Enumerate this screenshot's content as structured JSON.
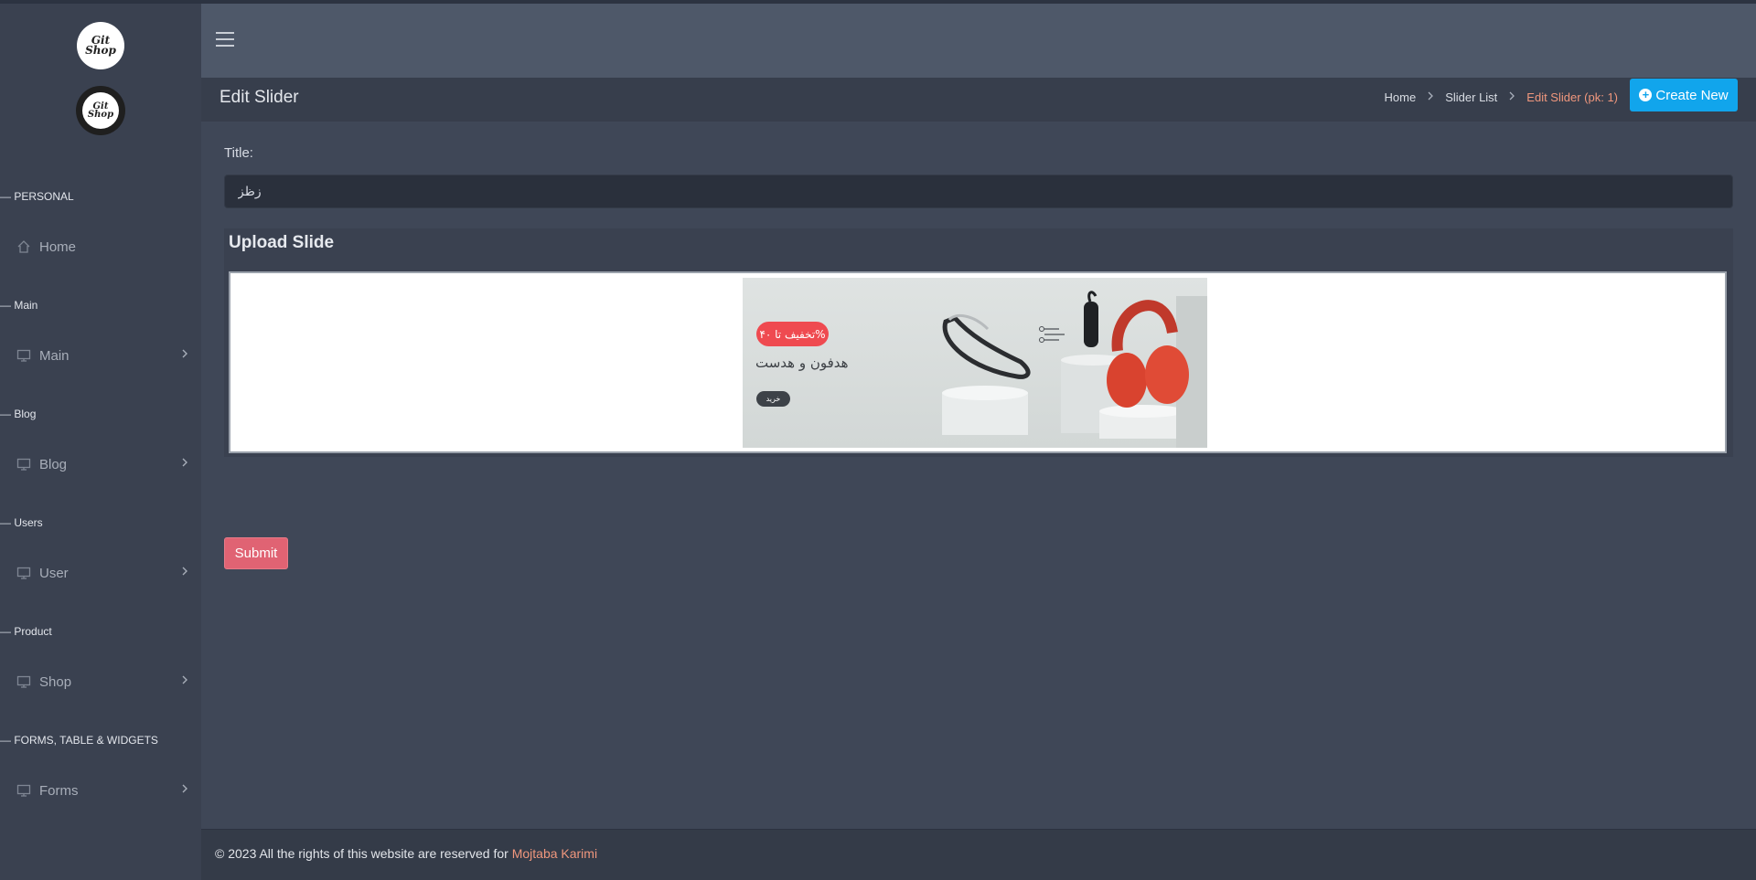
{
  "app": {
    "logo_text": "Git Shop"
  },
  "sidebar": {
    "sections": [
      {
        "label": "PERSONAL",
        "item": "Home",
        "icon": "home-icon",
        "has_chevron": false
      },
      {
        "label": "Main",
        "item": "Main",
        "icon": "monitor-icon",
        "has_chevron": true
      },
      {
        "label": "Blog",
        "item": "Blog",
        "icon": "monitor-icon",
        "has_chevron": true
      },
      {
        "label": "Users",
        "item": "User",
        "icon": "monitor-icon",
        "has_chevron": true
      },
      {
        "label": "Product",
        "item": "Shop",
        "icon": "monitor-icon",
        "has_chevron": true
      },
      {
        "label": "FORMS, TABLE & WIDGETS",
        "item": "Forms",
        "icon": "monitor-icon",
        "has_chevron": true
      }
    ],
    "dash": "—"
  },
  "header": {
    "menu_icon": "hamburger-icon"
  },
  "subheader": {
    "title": "Edit Slider",
    "breadcrumb": [
      "Home",
      "Slider List",
      "Edit Slider (pk: 1)"
    ],
    "create_label": "Create New"
  },
  "form": {
    "title_label": "Title:",
    "title_value": "زظز",
    "upload_title": "Upload Slide",
    "banner": {
      "badge": "تخفیف تا ۴۰%",
      "headline": "هدفون و هدست",
      "buy": "خرید"
    },
    "submit_label": "Submit"
  },
  "footer": {
    "text": "© 2023 All the rights of this website are reserved for",
    "author": "Mojtaba Karimi"
  },
  "colors": {
    "accent_blue": "#11a5ec",
    "submit_red": "#e06373",
    "link_orange": "#f0977d"
  }
}
